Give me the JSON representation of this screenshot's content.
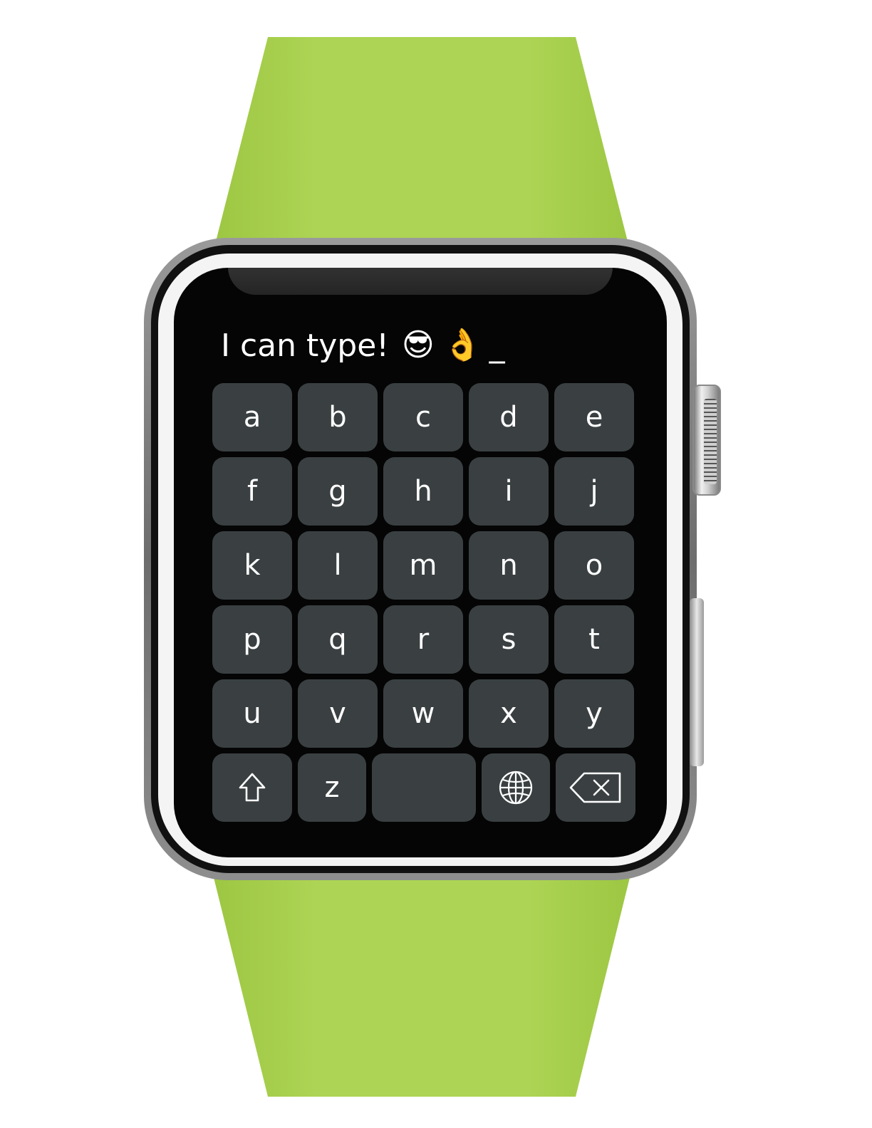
{
  "composer": {
    "text": "I can type!",
    "emoji_1": "😎",
    "emoji_2": "👌",
    "cursor": "_"
  },
  "keyboard": {
    "rows": [
      [
        "a",
        "b",
        "c",
        "d",
        "e"
      ],
      [
        "f",
        "g",
        "h",
        "i",
        "j"
      ],
      [
        "k",
        "l",
        "m",
        "n",
        "o"
      ],
      [
        "p",
        "q",
        "r",
        "s",
        "t"
      ],
      [
        "u",
        "v",
        "w",
        "x",
        "y"
      ]
    ],
    "bottom_row": {
      "shift_icon": "shift-arrow-icon",
      "z_label": "z",
      "space_label": "",
      "globe_icon": "globe-icon",
      "delete_icon": "backspace-icon"
    }
  },
  "colors": {
    "band": "#a8cf4e",
    "screen": "#050505",
    "key": "#3a4042",
    "key_text": "#ffffff"
  }
}
